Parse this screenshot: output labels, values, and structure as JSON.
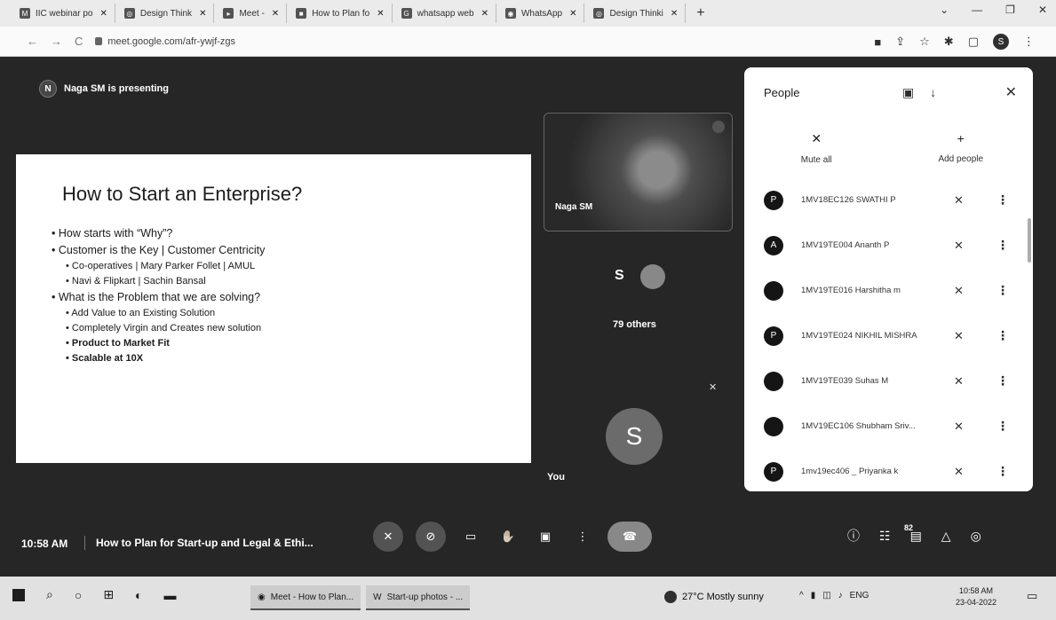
{
  "browser": {
    "tabs": [
      {
        "fav": "M",
        "label": "IIC webinar po"
      },
      {
        "fav": "◎",
        "label": "Design Think"
      },
      {
        "fav": "▸",
        "label": "Meet - "
      },
      {
        "fav": "■",
        "label": "How to Plan fo"
      },
      {
        "fav": "G",
        "label": "whatsapp web"
      },
      {
        "fav": "◉",
        "label": "WhatsApp"
      },
      {
        "fav": "◎",
        "label": "Design Thinki"
      }
    ],
    "new_tab": "+",
    "url": "meet.google.com/afr-ywjf-zgs"
  },
  "meet": {
    "presenter_initial": "N",
    "presenting_text": "Naga SM is presenting",
    "slide": {
      "title": "How to Start an Enterprise?",
      "bullets": [
        "How starts with “Why”?",
        "Customer is the Key | Customer Centricity",
        "Co-operatives | Mary Parker Follet | AMUL",
        "Navi & Flipkart | Sachin Bansal",
        "What is the Problem that we are solving?",
        "Add Value to an Existing Solution",
        "Completely Virgin and Creates new solution",
        "Product to Market Fit",
        "Scalable at 10X"
      ]
    },
    "video_name": "Naga SM",
    "others_initial": "S",
    "others_label": "79 others",
    "you_initial": "S",
    "you_label": "You"
  },
  "people_panel": {
    "title": "People",
    "mute_all": "Mute all",
    "add_people": "Add people",
    "participants": [
      {
        "initial": "P",
        "name": "1MV18EC126 SWATHI P"
      },
      {
        "initial": "A",
        "name": "1MV19TE004 Ananth P"
      },
      {
        "initial": "",
        "name": "1MV19TE016 Harshitha m"
      },
      {
        "initial": "P",
        "name": "1MV19TE024 NIKHIL MISHRA"
      },
      {
        "initial": "",
        "name": "1MV19TE039 Suhas M"
      },
      {
        "initial": "",
        "name": "1MV19EC106 Shubham Sriv..."
      },
      {
        "initial": "P",
        "name": "1mv19ec406 _ Priyanka k"
      }
    ]
  },
  "bottom_bar": {
    "time": "10:58 AM",
    "meeting_title": "How to Plan for Start-up and Legal & Ethi...",
    "people_count": "82"
  },
  "taskbar": {
    "apps": [
      {
        "label": "Meet - How to Plan..."
      },
      {
        "label": "Start-up photos - ..."
      }
    ],
    "weather": "27°C  Mostly sunny",
    "lang": "ENG",
    "time": "10:58 AM",
    "date": "23-04-2022"
  }
}
